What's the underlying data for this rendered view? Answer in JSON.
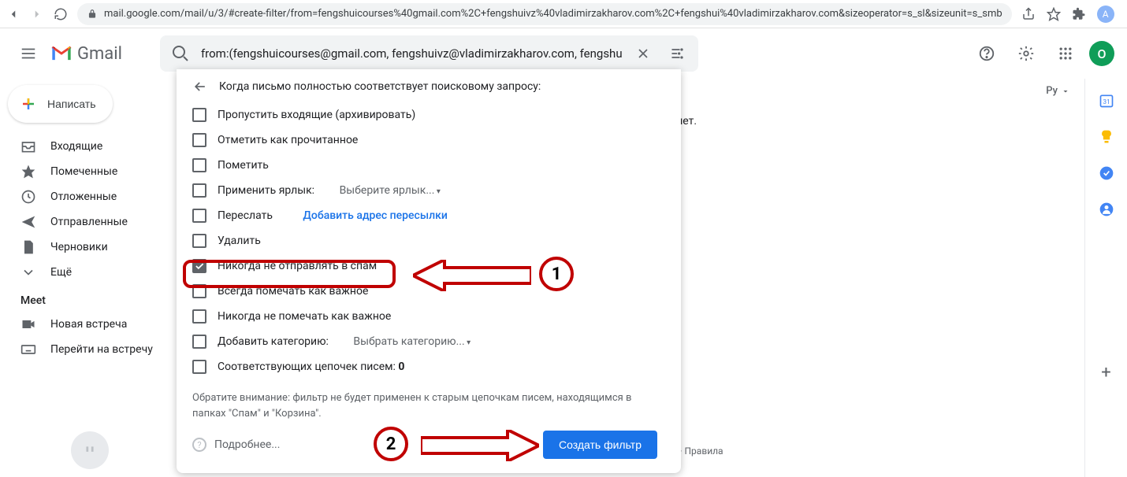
{
  "browser": {
    "url": "mail.google.com/mail/u/3/#create-filter/from=fengshuicourses%40gmail.com%2C+fengshuivz%40vladimirzakharov.com%2C+fengshui%40vladimirzakharov.com&sizeoperator=s_sl&sizeunit=s_smb",
    "avatar_letter": "A"
  },
  "header": {
    "logo_text": "Gmail",
    "search_value": "from:(fengshuicourses@gmail.com, fengshuivz@vladimirzakharov.com, fengshu",
    "avatar_letter": "O"
  },
  "compose_label": "Написать",
  "sidebar": {
    "items": [
      {
        "label": "Входящие"
      },
      {
        "label": "Помеченные"
      },
      {
        "label": "Отложенные"
      },
      {
        "label": "Отправленные"
      },
      {
        "label": "Черновики"
      },
      {
        "label": "Ещё"
      }
    ],
    "meet_header": "Meet",
    "meet_items": [
      {
        "label": "Новая встреча"
      },
      {
        "label": "Перейти на встречу"
      }
    ]
  },
  "input_chip": "Ру",
  "bg_text": ", нет.",
  "footer_text": "ость · Правила",
  "filter": {
    "title": "Когда письмо полностью соответствует поисковому запросу:",
    "options": [
      {
        "label": "Пропустить входящие (архивировать)",
        "checked": false
      },
      {
        "label": "Отметить как прочитанное",
        "checked": false
      },
      {
        "label": "Пометить",
        "checked": false
      },
      {
        "label": "Применить ярлык:",
        "dropdown": "Выберите ярлык...",
        "checked": false
      },
      {
        "label": "Переслать",
        "link": "Добавить адрес пересылки",
        "checked": false
      },
      {
        "label": "Удалить",
        "checked": false
      },
      {
        "label": "Никогда не отправлять в спам",
        "checked": true
      },
      {
        "label": "Всегда помечать как важное",
        "checked": false
      },
      {
        "label": "Никогда не помечать как важное",
        "checked": false
      },
      {
        "label": "Добавить категорию:",
        "dropdown": "Выбрать категорию...",
        "checked": false
      }
    ],
    "matching_prefix": "Соответствующих цепочек писем: ",
    "matching_count": "0",
    "note": "Обратите внимание: фильтр не будет применен к старым цепочкам писем, находящимся в папках \"Спам\" и \"Корзина\".",
    "more_label": "Подробнее...",
    "create_label": "Создать фильтр"
  },
  "annotations": {
    "num1": "1",
    "num2": "2"
  }
}
